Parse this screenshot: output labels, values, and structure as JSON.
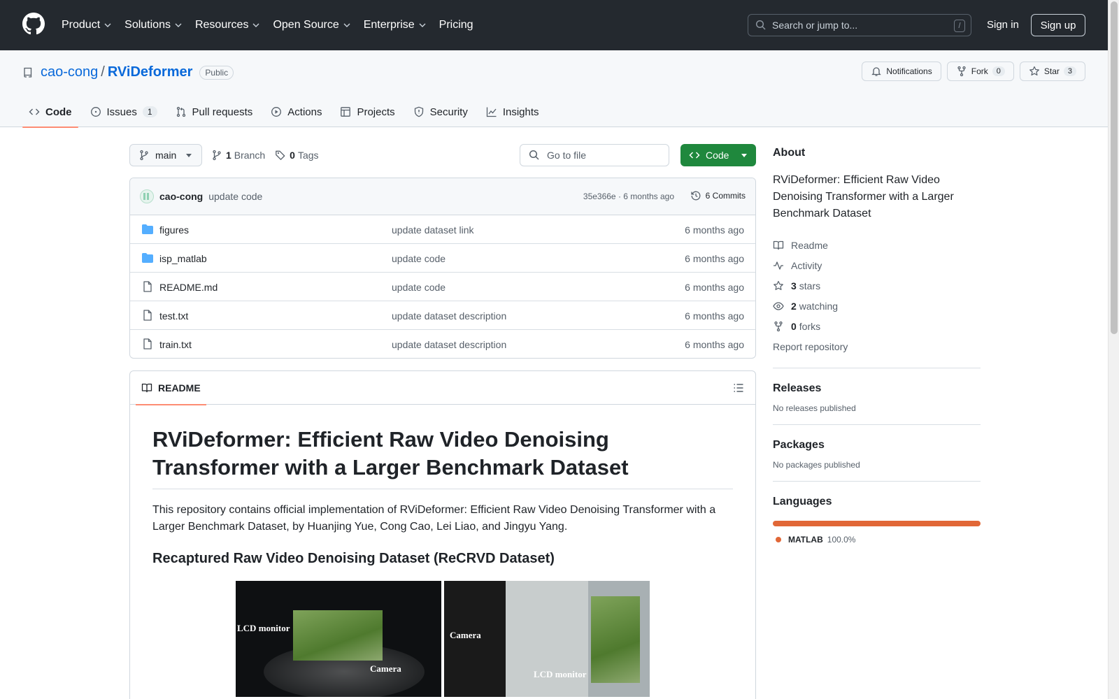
{
  "header": {
    "nav": [
      "Product",
      "Solutions",
      "Resources",
      "Open Source",
      "Enterprise",
      "Pricing"
    ],
    "search_placeholder": "Search or jump to...",
    "search_key": "/",
    "sign_in": "Sign in",
    "sign_up": "Sign up"
  },
  "repo": {
    "owner": "cao-cong",
    "sep": "/",
    "name": "RViDeformer",
    "visibility": "Public",
    "notifications": "Notifications",
    "fork_label": "Fork",
    "fork_count": "0",
    "star_label": "Star",
    "star_count": "3"
  },
  "tabs": [
    {
      "label": "Code",
      "icon": "code-icon"
    },
    {
      "label": "Issues",
      "icon": "issue-icon",
      "count": "1"
    },
    {
      "label": "Pull requests",
      "icon": "pull-request-icon"
    },
    {
      "label": "Actions",
      "icon": "play-icon"
    },
    {
      "label": "Projects",
      "icon": "table-icon"
    },
    {
      "label": "Security",
      "icon": "shield-icon"
    },
    {
      "label": "Insights",
      "icon": "graph-icon"
    }
  ],
  "toolbar": {
    "branch": "main",
    "branch_count": "1",
    "branch_label": "Branch",
    "tag_count": "0",
    "tag_label": "Tags",
    "goto_placeholder": "Go to file",
    "code_label": "Code"
  },
  "commit": {
    "author": "cao-cong",
    "message": "update code",
    "meta": "35e366e · 6 months ago",
    "commits": "6 Commits"
  },
  "files": [
    {
      "type": "folder",
      "name": "figures",
      "message": "update dataset link",
      "date": "6 months ago"
    },
    {
      "type": "folder",
      "name": "isp_matlab",
      "message": "update code",
      "date": "6 months ago"
    },
    {
      "type": "file",
      "name": "README.md",
      "message": "update code",
      "date": "6 months ago"
    },
    {
      "type": "file",
      "name": "test.txt",
      "message": "update dataset description",
      "date": "6 months ago"
    },
    {
      "type": "file",
      "name": "train.txt",
      "message": "update dataset description",
      "date": "6 months ago"
    }
  ],
  "readme": {
    "tab": "README",
    "h1": "RViDeformer: Efficient Raw Video Denoising Transformer with a Larger Benchmark Dataset",
    "p": "This repository contains official implementation of RViDeformer: Efficient Raw Video Denoising Transformer with a Larger Benchmark Dataset, by Huanjing Yue, Cong Cao, Lei Liao, and Jingyu Yang.",
    "h3": "Recaptured Raw Video Denoising Dataset (ReCRVD Dataset)",
    "img1_lcd": "LCD monitor",
    "img1_cam": "Camera",
    "img2_cam": "Camera",
    "img2_lcd": "LCD monitor"
  },
  "about": {
    "title": "About",
    "description": "RViDeformer: Efficient Raw Video Denoising Transformer with a Larger Benchmark Dataset",
    "readme": "Readme",
    "activity": "Activity",
    "stars_num": "3",
    "stars_label": "stars",
    "watching_num": "2",
    "watching_label": "watching",
    "forks_num": "0",
    "forks_label": "forks",
    "report": "Report repository"
  },
  "releases": {
    "title": "Releases",
    "empty": "No releases published"
  },
  "packages": {
    "title": "Packages",
    "empty": "No packages published"
  },
  "languages": {
    "title": "Languages",
    "name": "MATLAB",
    "pct": "100.0%",
    "color": "#e16737"
  }
}
